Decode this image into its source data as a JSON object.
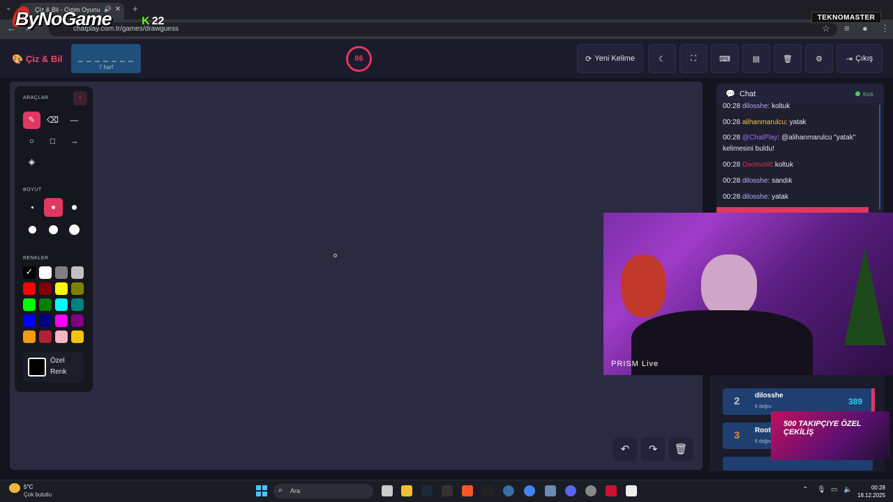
{
  "browser": {
    "tab_title": "Çiz & Bil - Çizim Oyunu",
    "url": "chatplay.com.tr/games/drawguess",
    "stream_logo": "ByNoGame",
    "kick_count": "22",
    "tekno": "TEKNOMASTER"
  },
  "app": {
    "brand": "Çiz & Bil",
    "word_mask": "_ _ _ _ _ _ _",
    "word_hint": "7 harf",
    "timer": "86",
    "buttons": {
      "new_word": "Yeni Kelime",
      "exit": "Çıkış"
    }
  },
  "tools": {
    "title": "ARAÇLAR",
    "size_title": "BOYUT",
    "colors_title": "RENKLER",
    "custom_color": "Özel Renk",
    "colors": [
      "#000000",
      "#ffffff",
      "#808080",
      "#c0c0c0",
      "#ff0000",
      "#800000",
      "#ffff00",
      "#808000",
      "#00ff00",
      "#008000",
      "#00ffff",
      "#008080",
      "#0000ff",
      "#000080",
      "#ff00ff",
      "#800080",
      "#f39c12",
      "#b22234",
      "#f4b6c2",
      "#f1c40f"
    ],
    "selected_color": "#000000",
    "selected_size": 2
  },
  "chat": {
    "title": "Chat",
    "platform": "Kick",
    "messages": [
      {
        "time": "00:28",
        "user": "dilosshe",
        "user_color": "#b9a7ff",
        "text": ": koltuk"
      },
      {
        "time": "00:28",
        "user": "alihanmarulcu",
        "user_color": "#f0c040",
        "text": ": yatak"
      },
      {
        "time": "00:28",
        "user": "@ChatPlay",
        "user_color": "#a070f0",
        "text": ": @alihanmarulcu \"yatak\" kelimesini buldu!"
      },
      {
        "time": "00:28",
        "user": "OxomoW",
        "user_color": "#e03040",
        "text": ": koltuk"
      },
      {
        "time": "00:28",
        "user": "dilosshe",
        "user_color": "#b9a7ff",
        "text": ": sandık"
      },
      {
        "time": "00:28",
        "user": "dilosshe",
        "user_color": "#b9a7ff",
        "text": ": yatak"
      }
    ]
  },
  "webcam": {
    "overlay_label": "PRISM Live"
  },
  "leaderboard": [
    {
      "rank": "2",
      "name": "dilosshe",
      "sub": "6 doğru",
      "score": "389",
      "rank_color": "#c0c8d8"
    },
    {
      "rank": "3",
      "name": "Roota",
      "sub": "6 doğru",
      "score": "",
      "rank_color": "#e08a3c"
    }
  ],
  "promo": {
    "text": "500 TAKIPÇIYE ÖZEL ÇEKİLİŞ"
  },
  "taskbar": {
    "weather_temp": "5°C",
    "weather_desc": "Çok bulutlu",
    "search": "Ara",
    "time": "00:28",
    "date": "18.12.2025"
  }
}
